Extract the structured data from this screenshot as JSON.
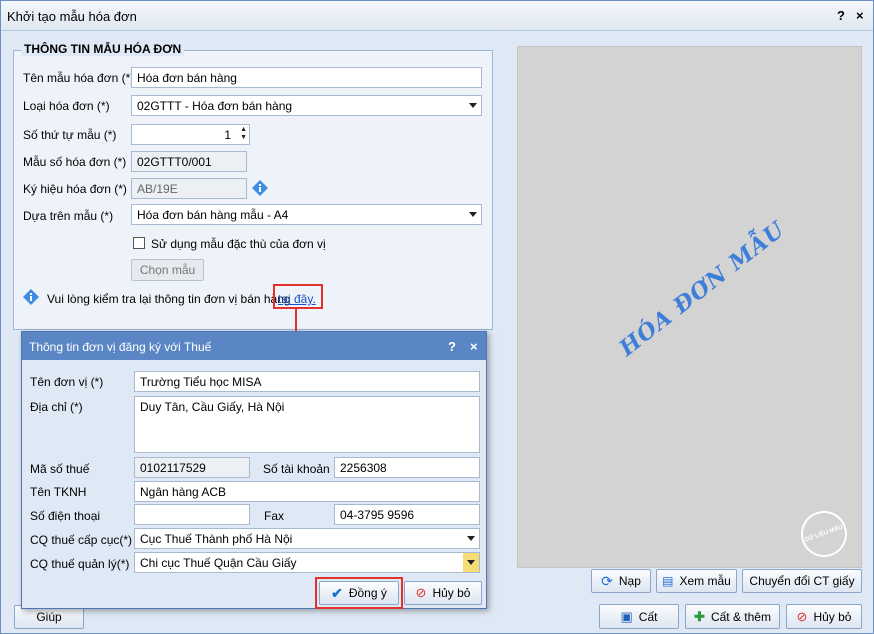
{
  "window": {
    "title": "Khởi tạo mẫu hóa đơn",
    "help": "?",
    "close": "×"
  },
  "form": {
    "section_title": "THÔNG TIN MẪU HÓA ĐƠN",
    "template_name_label": "Tên mẫu hóa đơn (*)",
    "template_name_value": "Hóa đơn bán hàng",
    "invoice_type_label": "Loại hóa đơn (*)",
    "invoice_type_value": "02GTTT - Hóa đơn bán hàng",
    "order_label": "Số thứ tự mẫu (*)",
    "order_value": "1",
    "template_no_label": "Mẫu số hóa đơn (*)",
    "template_no_value": "02GTTT0/001",
    "symbol_label": "Ký hiệu hóa đơn (*)",
    "symbol_value": "AB/19E",
    "based_on_label": "Dựa trên mẫu (*)",
    "based_on_value": "Hóa đơn bán hàng mẫu - A4",
    "special_checkbox_label": "Sử dụng mẫu đặc thù của đơn vị",
    "choose_button": "Chọn mẫu",
    "note_text": "Vui lòng kiểm tra lại thông tin đơn vị bán hàng",
    "note_link": "tại đây."
  },
  "preview": {
    "watermark": "HÓA ĐƠN MẪU",
    "stamp": "DỮ LIỆU MẪU"
  },
  "dialog": {
    "title": "Thông tin đơn vị đăng ký với Thuế",
    "help": "?",
    "close": "×",
    "unit_name_label": "Tên đơn vị (*)",
    "unit_name_value": "Trường Tiểu học MISA",
    "address_label": "Địa chỉ (*)",
    "address_value": "Duy Tân, Cầu Giấy, Hà Nội",
    "tax_code_label": "Mã số thuế",
    "tax_code_value": "0102117529",
    "account_label": "Số tài khoản",
    "account_value": "2256308",
    "bank_label": "Tên TKNH",
    "bank_value": "Ngân hàng ACB",
    "phone_label": "Số điện thoại",
    "phone_value": "",
    "fax_label": "Fax",
    "fax_value": "04-3795 9596",
    "tax_dept_label": "CQ thuế cấp cục(*)",
    "tax_dept_value": "Cục Thuế Thành phố Hà Nội",
    "tax_mgr_label": "CQ thuế quản lý(*)",
    "tax_mgr_value": "Chi cục Thuế Quận Cầu Giấy",
    "ok_button": "Đồng ý",
    "cancel_button": "Hủy bỏ"
  },
  "actions": {
    "help": "Giúp",
    "reload": "Nạp",
    "view_template": "Xem mẫu",
    "convert": "Chuyển đổi CT giấy",
    "save": "Cất",
    "save_add": "Cất & thêm",
    "cancel": "Hủy bỏ"
  },
  "colors": {
    "dialog_title_bg": "#5b86c5",
    "highlight": "#e3312e",
    "link": "#1a4fc8",
    "watermark": "#3f7ed8"
  }
}
